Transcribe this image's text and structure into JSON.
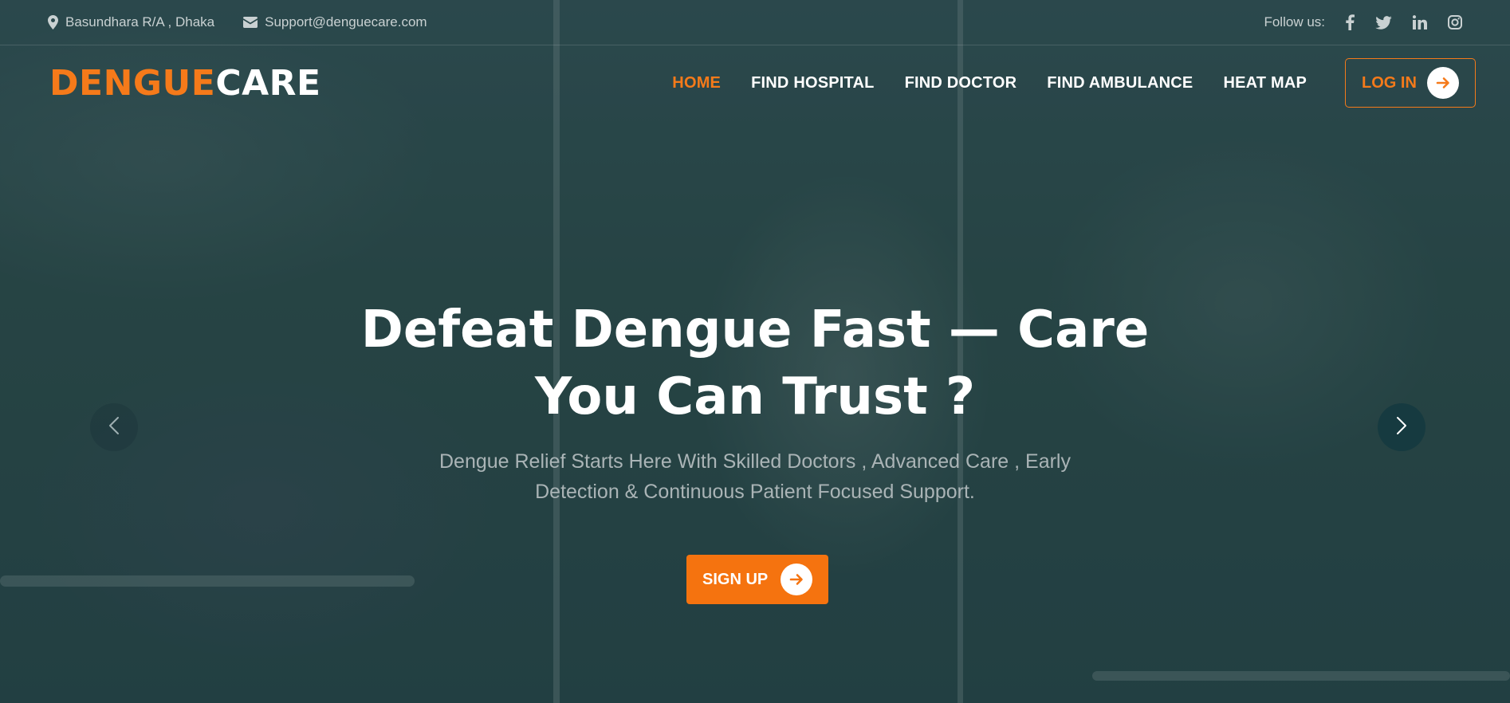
{
  "topbar": {
    "address": "Basundhara R/A , Dhaka",
    "email": "Support@denguecare.com",
    "follow_label": "Follow us:",
    "social": [
      "facebook-icon",
      "twitter-icon",
      "linkedin-icon",
      "instagram-icon"
    ]
  },
  "brand": {
    "part1": "DENGUE",
    "part2": "CARE"
  },
  "nav": {
    "items": [
      {
        "label": "HOME",
        "active": true
      },
      {
        "label": "FIND HOSPITAL",
        "active": false
      },
      {
        "label": "FIND DOCTOR",
        "active": false
      },
      {
        "label": "FIND AMBULANCE",
        "active": false
      },
      {
        "label": "HEAT MAP",
        "active": false
      }
    ],
    "login_label": "LOG IN"
  },
  "hero": {
    "headline_line1": "Defeat Dengue Fast — Care",
    "headline_line2": "You Can Trust ?",
    "subtitle_line1": "Dengue Relief Starts Here With Skilled Doctors , Advanced Care , Early",
    "subtitle_line2": "Detection & Continuous Patient Focused Support.",
    "cta_label": "SIGN UP"
  },
  "colors": {
    "accent": "#f57a1a",
    "cta": "#f5730f",
    "overlay": "#2d4a4f",
    "text_muted": "#aab4b6"
  }
}
